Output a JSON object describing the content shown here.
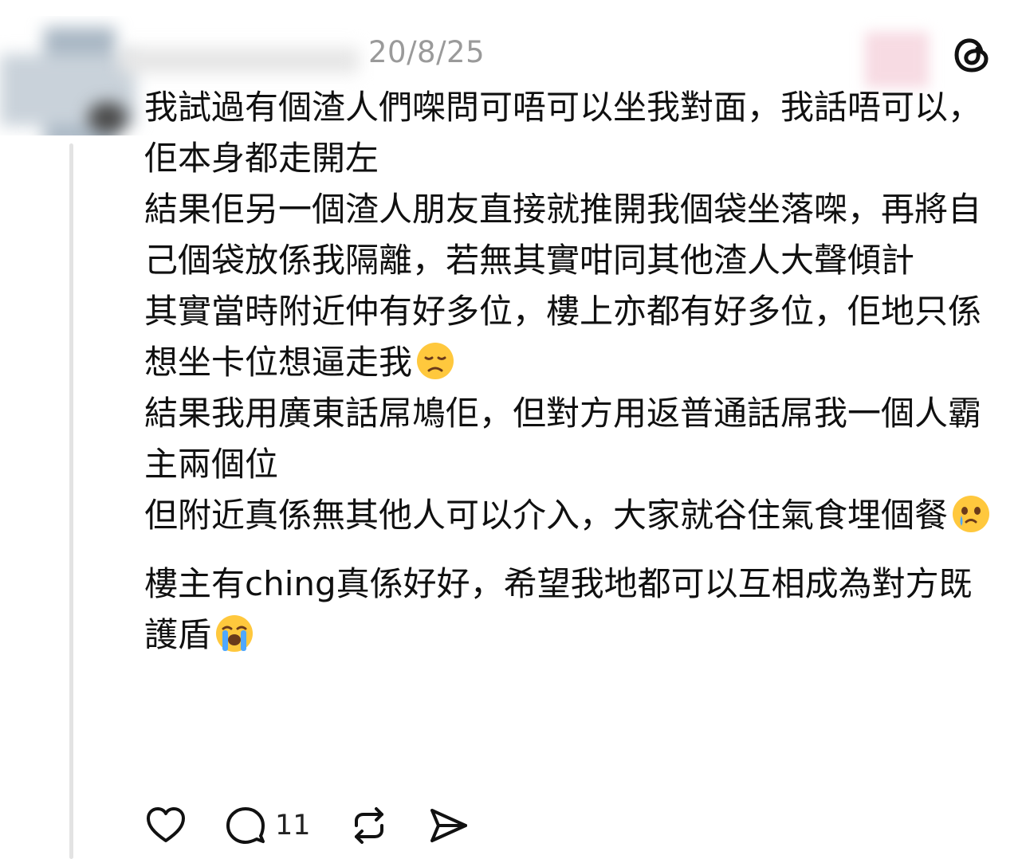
{
  "post": {
    "timestamp": "20/8/25",
    "paragraphs": [
      {
        "text": "我試過有個渣人們㗎問可唔可以坐我對面，我話唔可以，佢本身都走開左",
        "emoji": ""
      },
      {
        "text": "結果佢另一個渣人朋友直接就推開我個袋坐落㗎，再將自己個袋放係我隔離，若無其實咁同其他渣人大聲傾計",
        "emoji": ""
      },
      {
        "text": "其實當時附近仲有好多位，樓上亦都有好多位，佢地只係想坐卡位想逼走我",
        "emoji": "disappointed-face-icon"
      },
      {
        "text": "結果我用廣東話屌鳩佢，但對方用返普通話屌我一個人霸主兩個位",
        "emoji": ""
      },
      {
        "text": "但附近真係無其他人可以介入，大家就谷住氣食埋個餐",
        "emoji": "face-holding-back-tears-icon"
      },
      {
        "text": "樓主有ching真係好好，希望我地都可以互相成為對方既護盾",
        "emoji": "loudly-crying-face-icon"
      }
    ]
  },
  "actions": {
    "like_icon": "heart-icon",
    "reply_icon": "comment-icon",
    "reply_count": "11",
    "repost_icon": "repost-icon",
    "share_icon": "send-icon"
  },
  "brand": {
    "logo": "threads-logo-icon"
  }
}
